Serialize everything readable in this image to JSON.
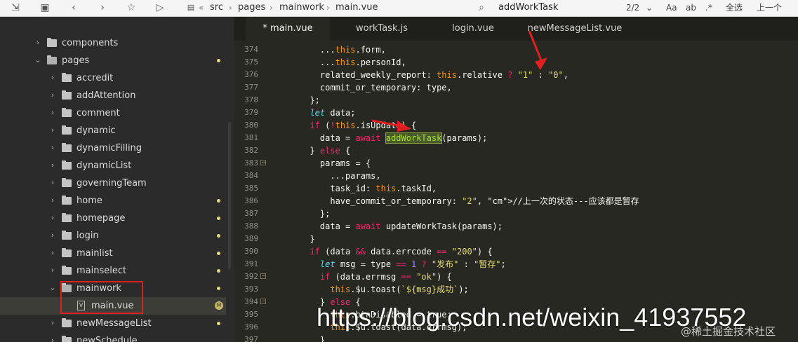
{
  "toolbar": {
    "breadcrumb": [
      "src",
      "pages",
      "mainwork",
      "main.vue"
    ],
    "search_query": "addWorkTask",
    "match_count": "2/2",
    "aa_label": "Aa",
    "word_label": "ab",
    "regex_label": ".*",
    "select_all": "全选",
    "prev_match": "上一个",
    "icons": [
      "import-icon",
      "save-icon",
      "back-icon",
      "forward-icon",
      "star-icon",
      "run-icon",
      "logo-icon",
      "search-icon",
      "chevron-down-icon"
    ]
  },
  "sidebar": {
    "items": [
      {
        "label": "components",
        "expanded": false,
        "dot": false
      },
      {
        "label": "pages",
        "expanded": true,
        "dot": true
      },
      {
        "label": "accredit",
        "expanded": false,
        "dot": false
      },
      {
        "label": "addAttention",
        "expanded": false,
        "dot": false
      },
      {
        "label": "comment",
        "expanded": false,
        "dot": false
      },
      {
        "label": "dynamic",
        "expanded": false,
        "dot": false
      },
      {
        "label": "dynamicFilling",
        "expanded": false,
        "dot": false
      },
      {
        "label": "dynamicList",
        "expanded": false,
        "dot": false
      },
      {
        "label": "governingTeam",
        "expanded": false,
        "dot": false
      },
      {
        "label": "home",
        "expanded": false,
        "dot": true
      },
      {
        "label": "homepage",
        "expanded": false,
        "dot": true
      },
      {
        "label": "login",
        "expanded": false,
        "dot": true
      },
      {
        "label": "mainlist",
        "expanded": false,
        "dot": true
      },
      {
        "label": "mainselect",
        "expanded": false,
        "dot": true
      },
      {
        "label": "mainwork",
        "expanded": true,
        "dot": true
      },
      {
        "label": "main.vue",
        "file": true,
        "badge": "M"
      },
      {
        "label": "newMessageList",
        "expanded": false,
        "dot": true
      },
      {
        "label": "newSchedule",
        "expanded": false,
        "dot": false
      }
    ]
  },
  "tabs": [
    {
      "label": "* main.vue",
      "active": true
    },
    {
      "label": "workTask.js",
      "active": false
    },
    {
      "label": "login.vue",
      "active": false
    },
    {
      "label": "newMessageList.vue",
      "active": false
    }
  ],
  "code": {
    "line_numbers": [
      "374",
      "375",
      "376",
      "377",
      "378",
      "379",
      "380",
      "381",
      "382",
      "383",
      "384",
      "385",
      "386",
      "387",
      "388",
      "389",
      "390",
      "391",
      "392",
      "393",
      "394",
      "395",
      "396",
      "397"
    ],
    "lines": [
      "    ...this.form,",
      "    ...this.personId,",
      "    related_weekly_report: this.relative ? \"1\" : \"0\",",
      "    commit_or_temporary: type,",
      "  };",
      "  let data;",
      "  if (!this.isUpdate) {",
      "    data = await addWorkTask(params);",
      "  } else {",
      "    params = {",
      "      ...params,",
      "      task_id: this.taskId,",
      "      have_commit_or_temporary: \"2\", //上一次的状态---应该都是暂存",
      "    };",
      "    data = await updateWorkTask(params);",
      "  }",
      "  if (data && data.errcode == \"200\") {",
      "    let msg = type == 1 ? \"发布\" : \"暂存\";",
      "    if (data.errmsg == \"ok\") {",
      "      this.$u.toast(`${msg}成功`);",
      "    } else {",
      "      this.btnDisabled = true;",
      "      this.$u.toast(data.errmsg);",
      "    }"
    ]
  },
  "watermark": "https://blog.csdn.net/weixin_41937552",
  "watermark_small": "@稀土掘金技术社区"
}
